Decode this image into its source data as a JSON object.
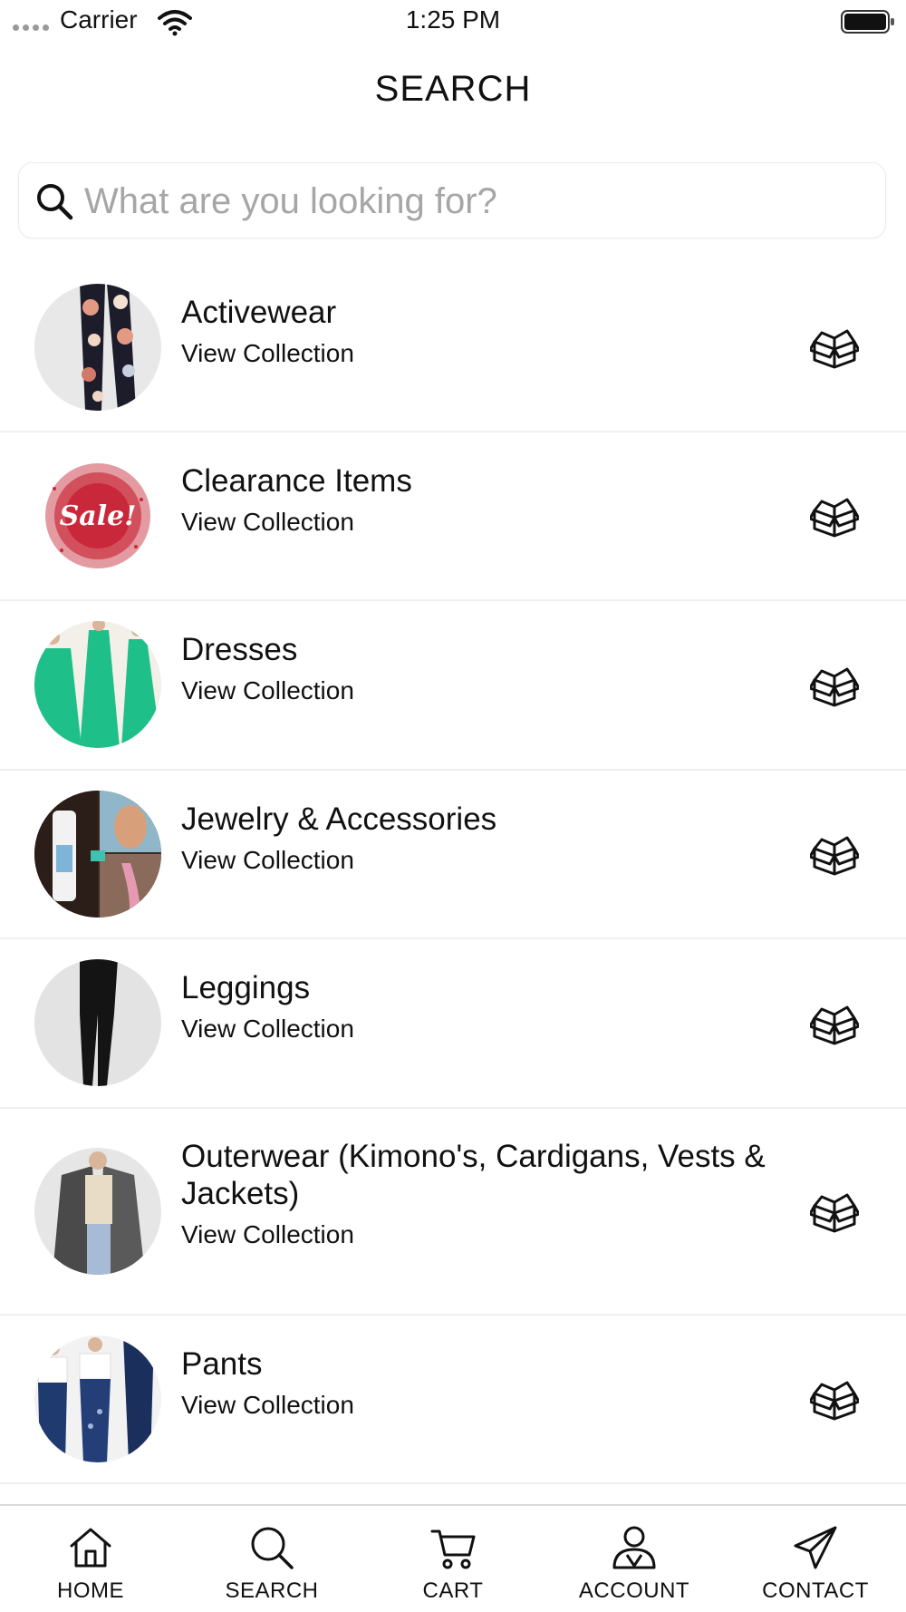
{
  "status_bar": {
    "carrier": "Carrier",
    "time": "1:25 PM",
    "icons": [
      "signal-dots-icon",
      "wifi-icon",
      "battery-icon"
    ]
  },
  "header": {
    "title": "SEARCH"
  },
  "search": {
    "placeholder": "What are you looking for?",
    "value": "",
    "icon": "search-icon"
  },
  "collections": [
    {
      "title": "Activewear",
      "subtitle": "View Collection",
      "action_icon": "gift-box-icon"
    },
    {
      "title": "Clearance Items",
      "subtitle": "View Collection",
      "action_icon": "gift-box-icon",
      "thumbnail_text": "Sale!"
    },
    {
      "title": "Dresses",
      "subtitle": "View Collection",
      "action_icon": "gift-box-icon"
    },
    {
      "title": "Jewelry & Accessories",
      "subtitle": "View Collection",
      "action_icon": "gift-box-icon"
    },
    {
      "title": "Leggings",
      "subtitle": "View Collection",
      "action_icon": "gift-box-icon"
    },
    {
      "title": "Outerwear (Kimono's, Cardigans, Vests & Jackets)",
      "subtitle": "View Collection",
      "action_icon": "gift-box-icon"
    },
    {
      "title": "Pants",
      "subtitle": "View Collection",
      "action_icon": "gift-box-icon"
    }
  ],
  "tab_bar": {
    "tabs": [
      {
        "label": "HOME",
        "icon": "home-icon"
      },
      {
        "label": "SEARCH",
        "icon": "search-icon"
      },
      {
        "label": "CART",
        "icon": "cart-icon"
      },
      {
        "label": "ACCOUNT",
        "icon": "account-icon"
      },
      {
        "label": "CONTACT",
        "icon": "paper-plane-icon"
      }
    ]
  },
  "colors": {
    "text": "#111111",
    "placeholder": "#a6a6a6",
    "divider": "#f0f0f0",
    "background": "#ffffff",
    "teal_dress": "#1fbf8a",
    "sale_red": "#c8283a"
  }
}
